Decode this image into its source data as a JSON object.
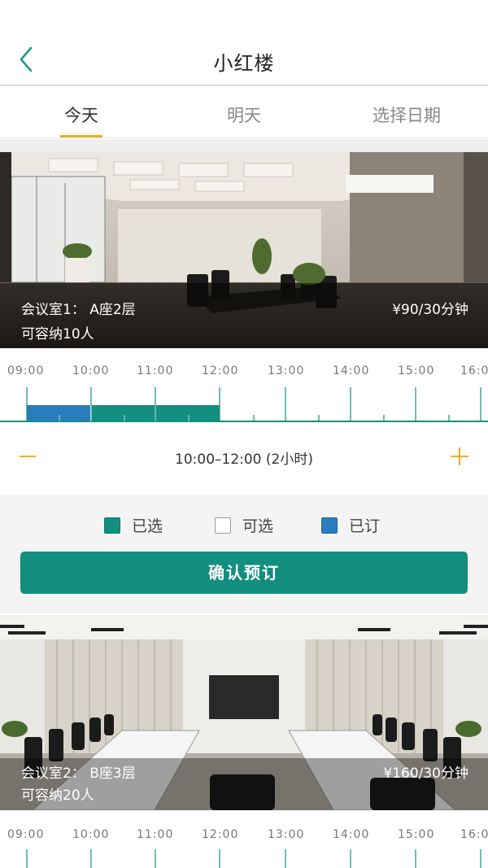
{
  "header": {
    "title": "小红楼",
    "back_icon": "chevron-left-icon"
  },
  "tabs": [
    {
      "label": "今天",
      "active": true
    },
    {
      "label": "明天",
      "active": false
    },
    {
      "label": "选择日期",
      "active": false
    }
  ],
  "rooms": [
    {
      "name": "会议室1：  A座2层",
      "capacity": "可容纳10人",
      "price": "¥90/30分钟",
      "timeline": {
        "labels": [
          "09:00",
          "10:00",
          "11:00",
          "12:00",
          "13:00",
          "14:00",
          "15:00",
          "16:0"
        ],
        "booked": [
          "09:00-10:00"
        ],
        "selected": [
          "10:00-12:00"
        ]
      }
    },
    {
      "name": "会议室2：  B座3层",
      "capacity": "可容纳20人",
      "price": "¥160/30分钟",
      "timeline": {
        "labels": [
          "09:00",
          "10:00",
          "11:00",
          "12:00",
          "13:00",
          "14:00",
          "15:00",
          "16:0"
        ]
      }
    }
  ],
  "selection": {
    "range": "10:00–12:00 (2小时)"
  },
  "legend": [
    {
      "label": "已选",
      "color": "#138f80"
    },
    {
      "label": "可选",
      "color": "#ffffff"
    },
    {
      "label": "已订",
      "color": "#2a7dbd"
    }
  ],
  "actions": {
    "confirm_label": "确认预订"
  },
  "colors": {
    "accent": "#f1ad1e",
    "primary": "#138f80",
    "booked": "#2a7dbd"
  }
}
